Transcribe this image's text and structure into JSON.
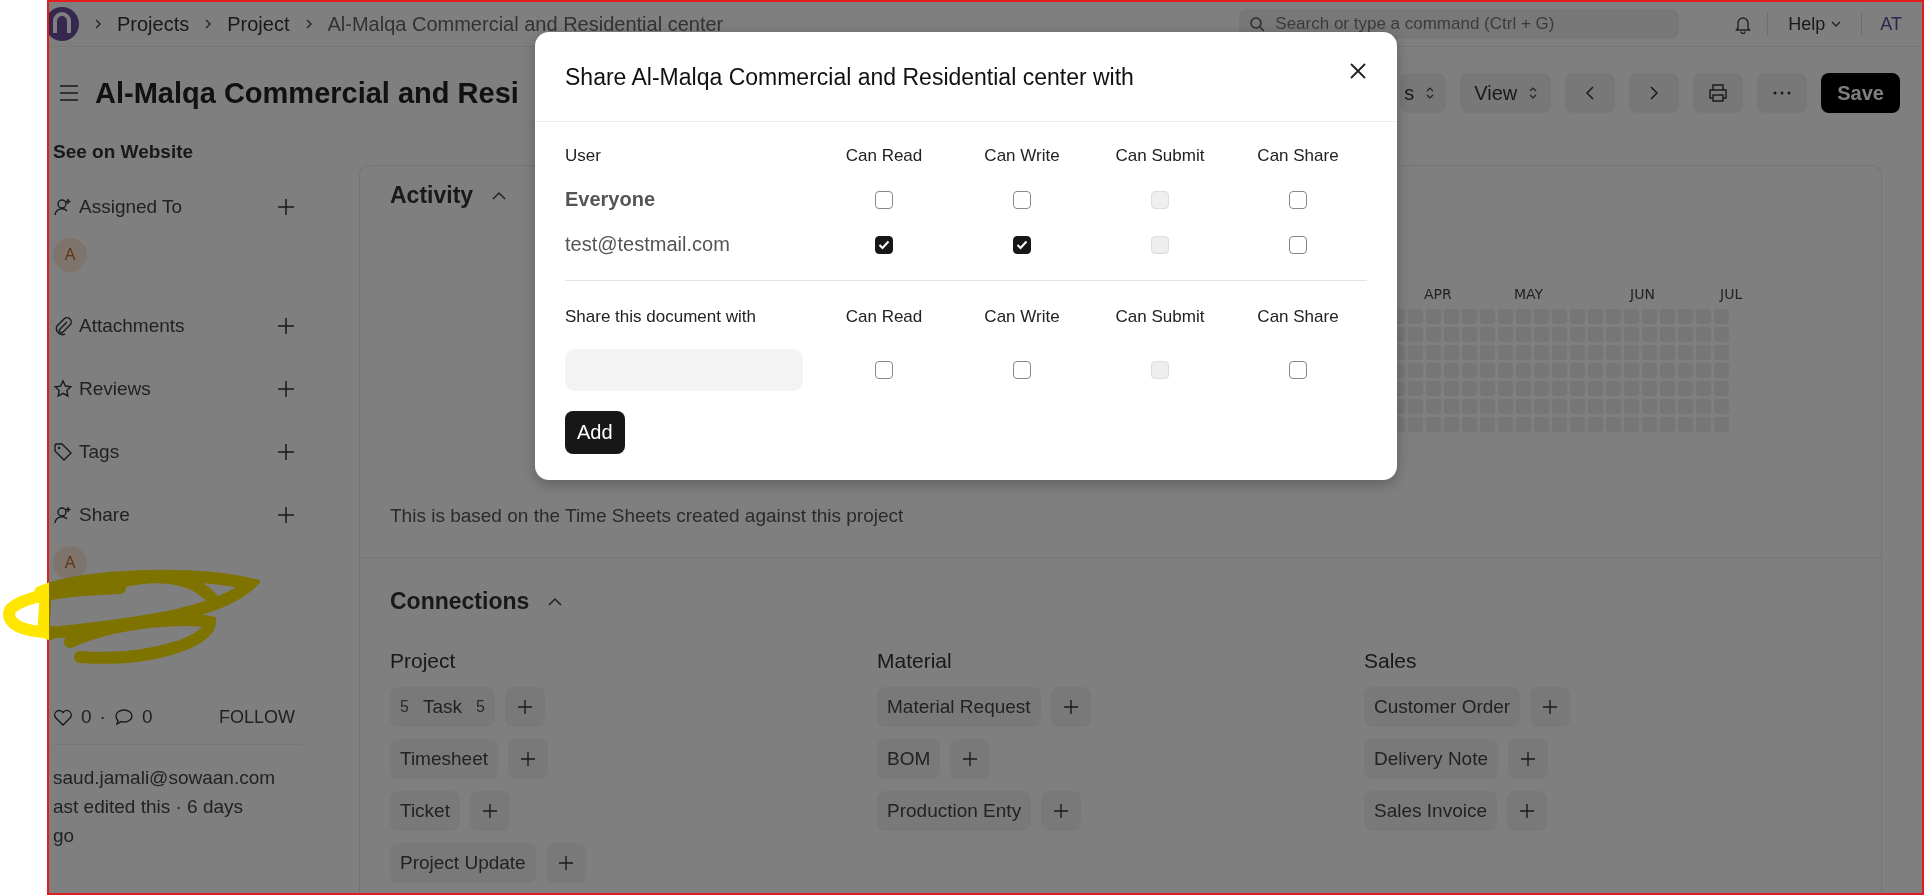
{
  "navbar": {
    "breadcrumbs": [
      "Projects",
      "Project",
      "Al-Malqa Commercial and Residential center"
    ],
    "search": {
      "placeholder": "Search or type a command (Ctrl + G)"
    },
    "help": "Help",
    "avatar": "AT"
  },
  "page_header": {
    "title": "Al-Malqa Commercial and Resi",
    "partial_dropdown": "s",
    "view": "View",
    "save": "Save"
  },
  "sidebar": {
    "link": "See on Website",
    "sections": [
      {
        "kind": "assign",
        "label": "Assigned To",
        "avatar": "A"
      },
      {
        "kind": "attach",
        "label": "Attachments"
      },
      {
        "kind": "review",
        "label": "Reviews"
      },
      {
        "kind": "tag",
        "label": "Tags"
      },
      {
        "kind": "share",
        "label": "Share",
        "avatar": "A"
      }
    ],
    "likes": "0",
    "separator": "·",
    "comments": "0",
    "follow": "FOLLOW",
    "owner": "saud.jamali@sowaan.com",
    "edited": "ast edited this · 6 days",
    "edited_tail": "go"
  },
  "activity": {
    "title": "Activity",
    "months": [
      "APR",
      "MAY",
      "JUN",
      "JUL"
    ],
    "note": "This is based on the Time Sheets created against this project"
  },
  "connections": {
    "title": "Connections",
    "groups": [
      {
        "title": "Project",
        "items": [
          {
            "label": "Task",
            "count": "5",
            "open_count": "5"
          },
          {
            "label": "Timesheet"
          },
          {
            "label": "Ticket"
          },
          {
            "label": "Project Update"
          }
        ]
      },
      {
        "title": "Material",
        "items": [
          {
            "label": "Material Request"
          },
          {
            "label": "BOM"
          },
          {
            "label": "Production Enty"
          }
        ]
      },
      {
        "title": "Sales",
        "items": [
          {
            "label": "Customer Order"
          },
          {
            "label": "Delivery Note"
          },
          {
            "label": "Sales Invoice"
          }
        ]
      }
    ]
  },
  "modal": {
    "title": "Share Al-Malqa Commercial and Residential center with",
    "user_header": "User",
    "columns": [
      "Can Read",
      "Can Write",
      "Can Submit",
      "Can Share"
    ],
    "users": [
      {
        "name": "Everyone",
        "kind": "group",
        "permissions": [
          {
            "checked": false,
            "disabled": false
          },
          {
            "checked": false,
            "disabled": false
          },
          {
            "checked": false,
            "disabled": true
          },
          {
            "checked": false,
            "disabled": false
          }
        ]
      },
      {
        "name": "test@testmail.com",
        "kind": "user",
        "permissions": [
          {
            "checked": true,
            "disabled": false
          },
          {
            "checked": true,
            "disabled": false
          },
          {
            "checked": false,
            "disabled": true
          },
          {
            "checked": false,
            "disabled": false
          }
        ]
      }
    ],
    "share": {
      "label": "Share this document with",
      "columns": [
        "Can Read",
        "Can Write",
        "Can Submit",
        "Can Share"
      ],
      "permissions": [
        {
          "checked": false,
          "disabled": false
        },
        {
          "checked": false,
          "disabled": false
        },
        {
          "checked": false,
          "disabled": true
        },
        {
          "checked": false,
          "disabled": false
        }
      ],
      "button": "Add"
    }
  }
}
